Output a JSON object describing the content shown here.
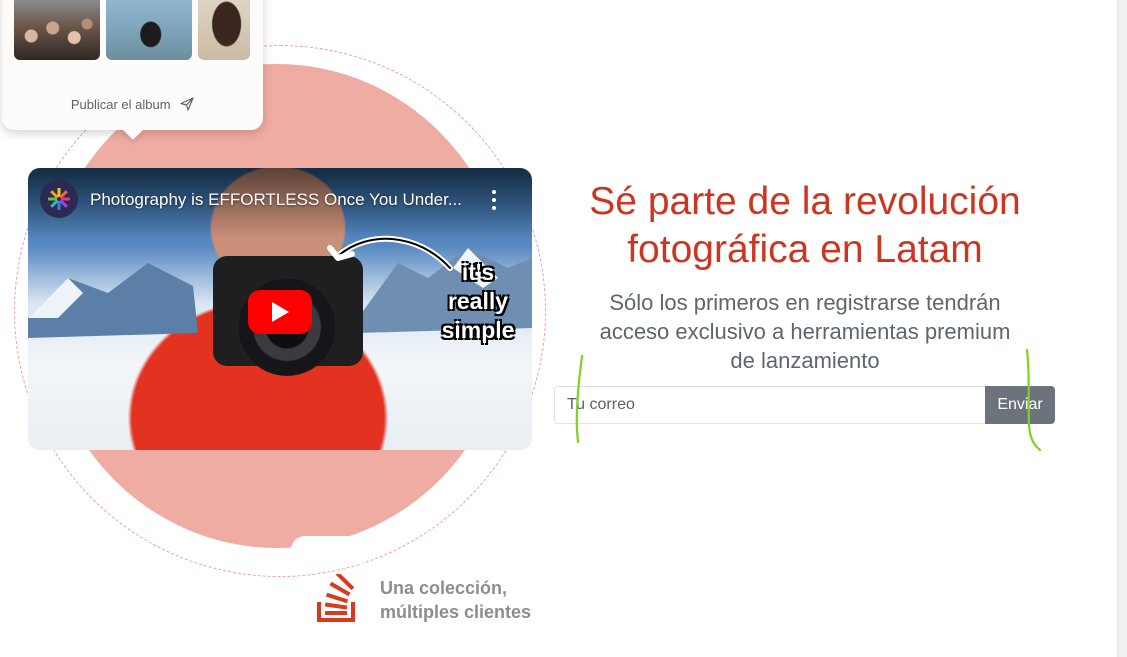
{
  "album_card": {
    "publish_label": "Publicar el album",
    "send_icon": "send-icon",
    "thumbnails": [
      "graduation-crowd-photo",
      "graduate-throwing-cap-photo",
      "couple-photo"
    ]
  },
  "video": {
    "channel_icon": "channel-logo-icon",
    "title": "Photography is EFFORTLESS Once You Under...",
    "menu_icon": "more-vert-icon",
    "play_icon": "youtube-play-icon",
    "thumbnail_text": [
      "it's",
      "really",
      "simple"
    ]
  },
  "brand": {
    "logo_icon": "stack-logo-icon",
    "tagline": [
      "Una colección,",
      "múltiples clientes"
    ]
  },
  "hero": {
    "headline": [
      "Sé parte de la revolución",
      "fotográfica en Latam"
    ],
    "subheadline": [
      "Sólo los primeros en registrarse tendrán",
      "acceso exclusivo a herramientas premium",
      "de lanzamiento"
    ]
  },
  "signup": {
    "email_placeholder": "Tu correo",
    "email_value": "",
    "submit_label": "Enviar"
  },
  "colors": {
    "accent": "#cc3520",
    "circle": "#efaca2",
    "button": "#6c737c",
    "annotation": "#7ed321"
  }
}
